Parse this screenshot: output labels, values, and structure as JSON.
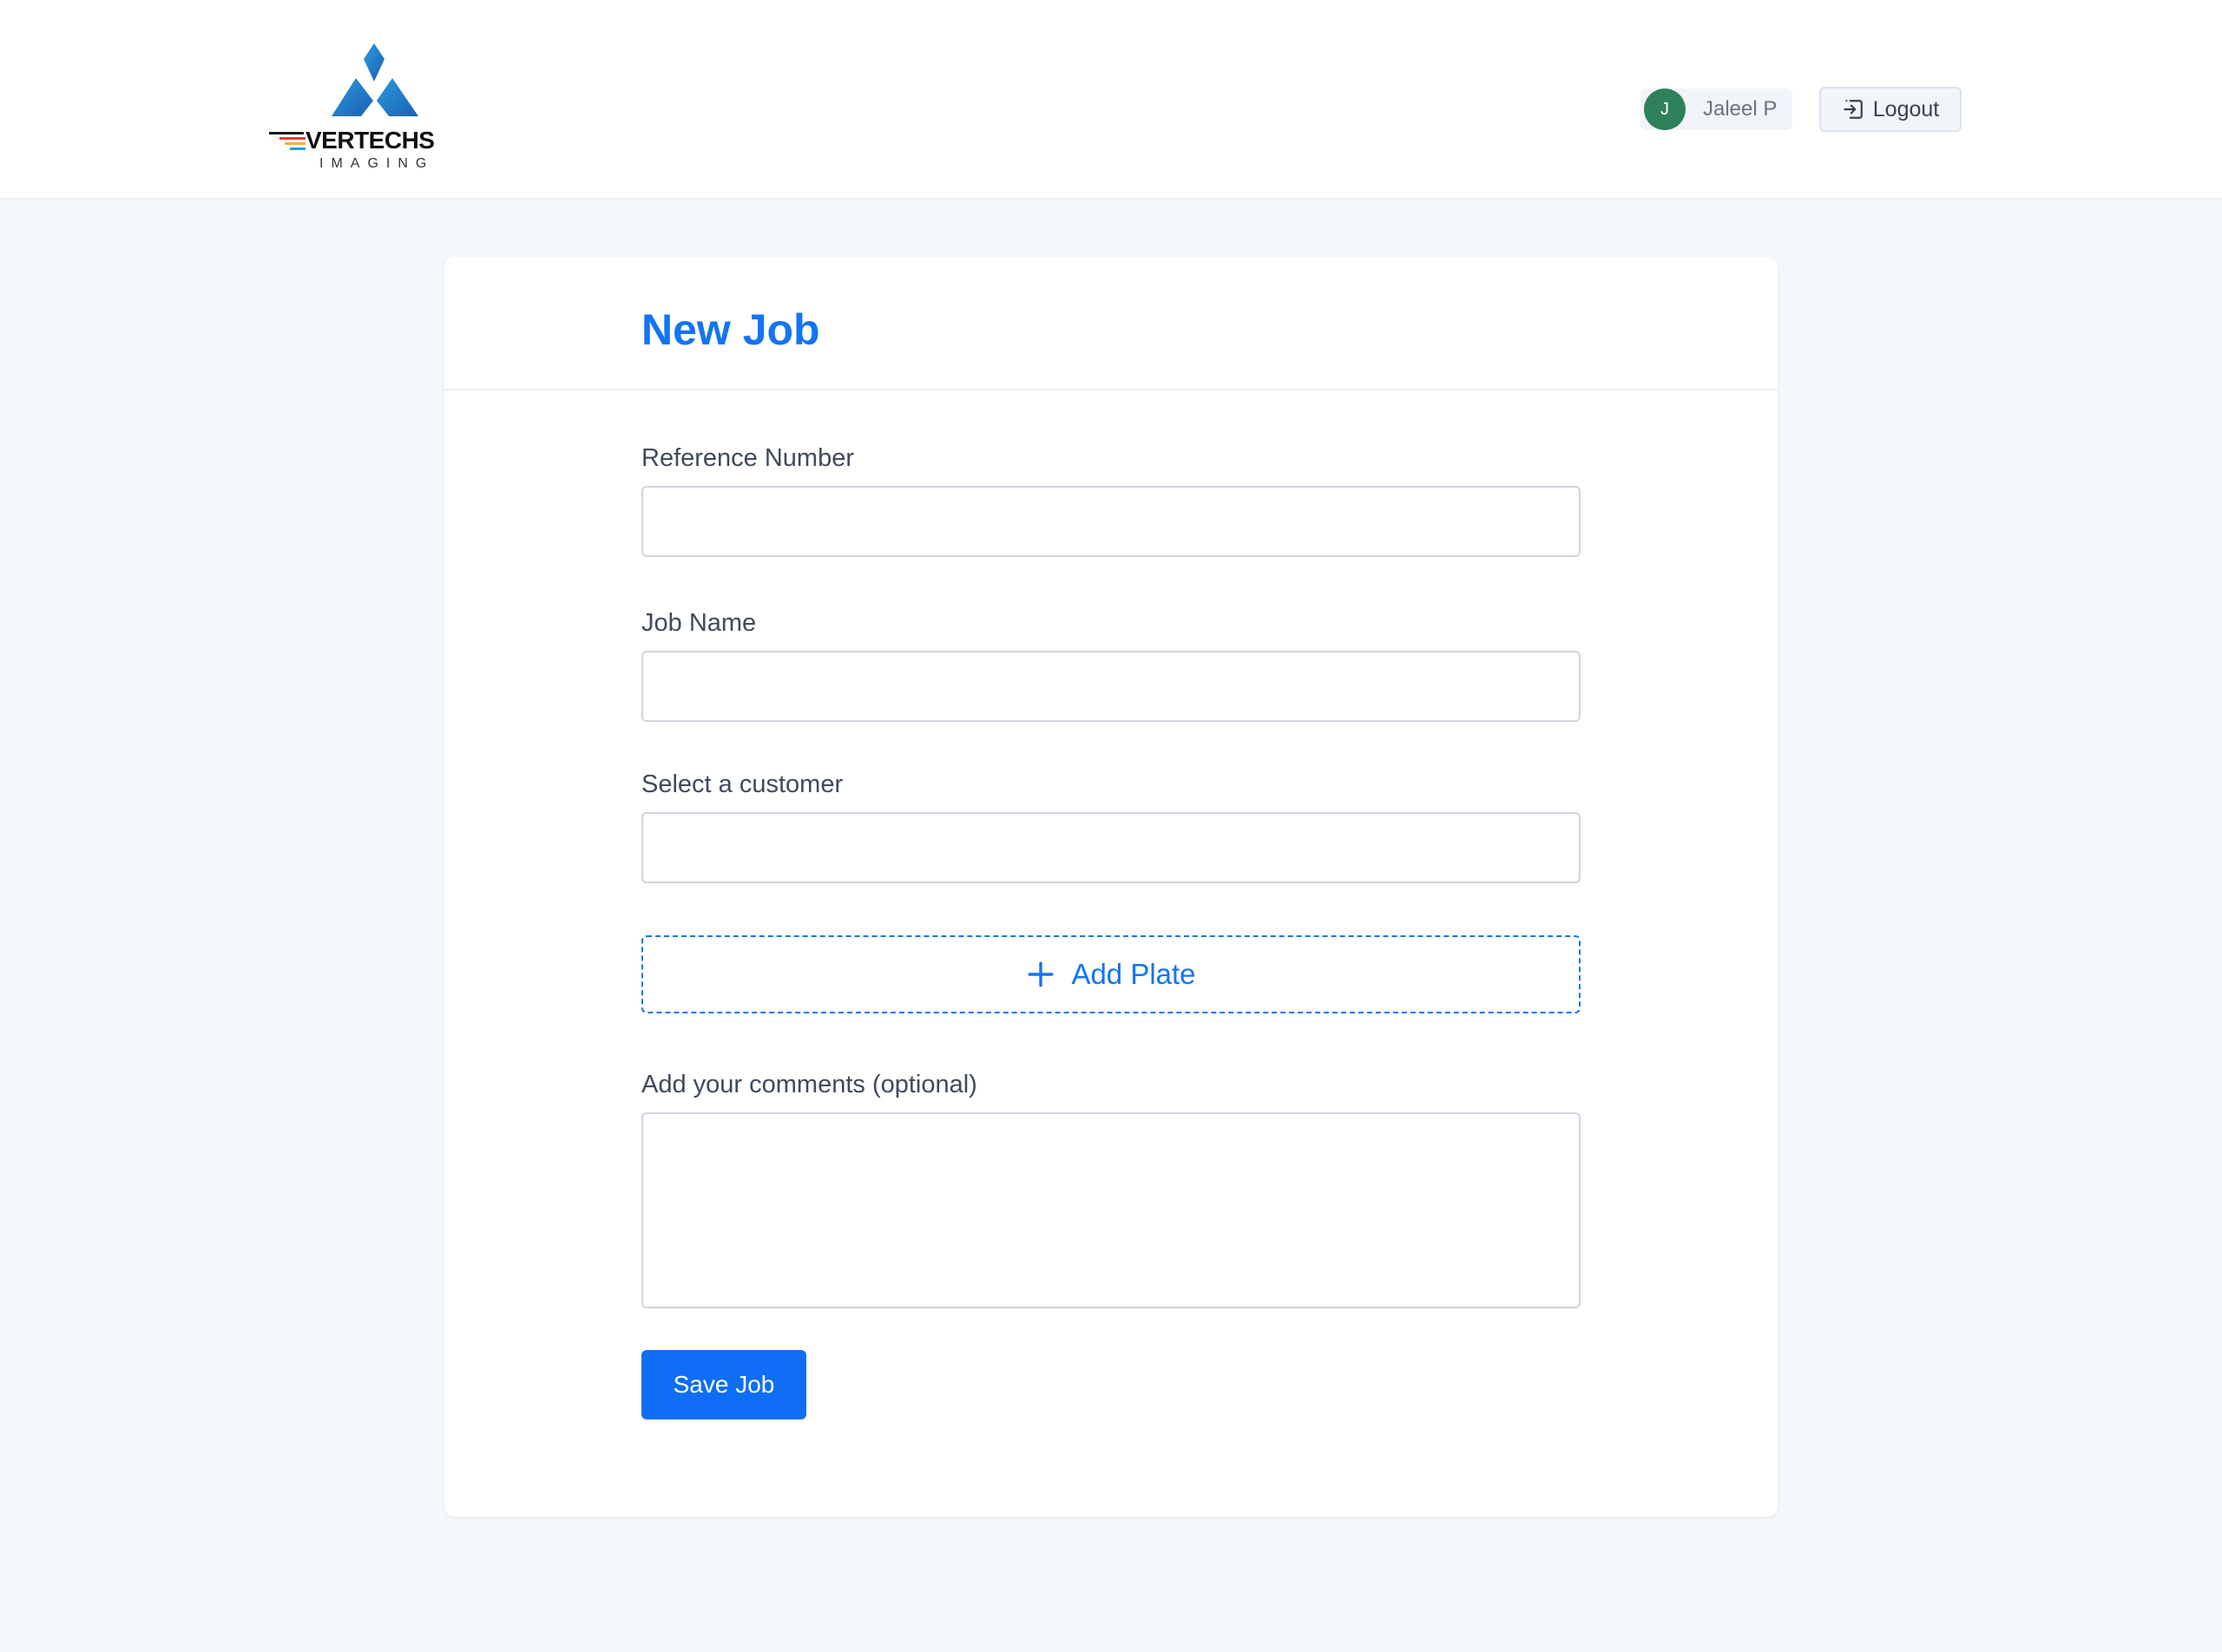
{
  "header": {
    "logo": {
      "name": "VERTECHS",
      "subtitle": "IMAGING"
    },
    "user": {
      "avatar_initial": "J",
      "name": "Jaleel P",
      "avatar_color": "#2e8159"
    },
    "logout_label": "Logout"
  },
  "form": {
    "title": "New Job",
    "reference_number": {
      "label": "Reference Number",
      "value": ""
    },
    "job_name": {
      "label": "Job Name",
      "value": ""
    },
    "customer": {
      "label": "Select a customer",
      "value": ""
    },
    "add_plate_label": "Add Plate",
    "comments": {
      "label": "Add your comments (optional)",
      "value": ""
    },
    "save_label": "Save Job"
  },
  "colors": {
    "accent": "#1474f2",
    "primary_button": "#0f6ef5",
    "page_background": "#f5f8fa"
  },
  "icons": {
    "logout": "logout-icon",
    "add": "plus-icon",
    "logo": "vertechs-logo"
  }
}
